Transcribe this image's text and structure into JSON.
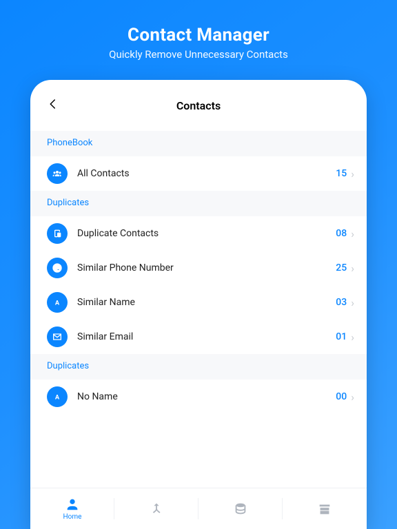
{
  "hero": {
    "title": "Contact Manager",
    "subtitle": "Quickly Remove Unnecessary Contacts"
  },
  "nav": {
    "title": "Contacts"
  },
  "sections": [
    {
      "label": "PhoneBook",
      "rows": [
        {
          "icon": "group",
          "title": "All Contacts",
          "count": "15"
        }
      ]
    },
    {
      "label": "Duplicates",
      "rows": [
        {
          "icon": "dup",
          "title": "Duplicate Contacts",
          "count": "08"
        },
        {
          "icon": "phone",
          "title": "Similar Phone Number",
          "count": "25"
        },
        {
          "icon": "letter",
          "title": "Similar Name",
          "count": "03"
        },
        {
          "icon": "mail",
          "title": "Similar Email",
          "count": "01"
        }
      ]
    },
    {
      "label": "Duplicates",
      "rows": [
        {
          "icon": "letter",
          "title": "No Name",
          "count": "00"
        }
      ]
    }
  ],
  "tabs": {
    "home": "Home"
  }
}
